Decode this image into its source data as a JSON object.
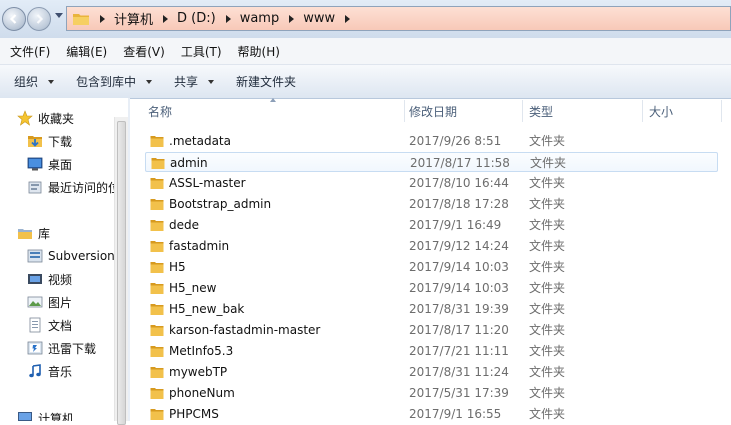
{
  "address_bar": {
    "crumbs": [
      "计算机",
      "D (D:)",
      "wamp",
      "www"
    ]
  },
  "menu": [
    "文件(F)",
    "编辑(E)",
    "查看(V)",
    "工具(T)",
    "帮助(H)"
  ],
  "commands": [
    {
      "label": "组织",
      "dropdown": true
    },
    {
      "label": "包含到库中",
      "dropdown": true
    },
    {
      "label": "共享",
      "dropdown": true
    },
    {
      "label": "新建文件夹",
      "dropdown": false
    }
  ],
  "nav_pane": {
    "favorites": {
      "label": "收藏夹",
      "icon": "star-icon",
      "items": [
        {
          "label": "下载",
          "icon": "download-folder-icon"
        },
        {
          "label": "桌面",
          "icon": "desktop-icon"
        },
        {
          "label": "最近访问的位",
          "icon": "recent-places-icon"
        }
      ]
    },
    "libraries": {
      "label": "库",
      "icon": "library-icon",
      "items": [
        {
          "label": "Subversion",
          "icon": "subversion-library-icon"
        },
        {
          "label": "视频",
          "icon": "video-library-icon"
        },
        {
          "label": "图片",
          "icon": "pictures-library-icon"
        },
        {
          "label": "文档",
          "icon": "documents-library-icon"
        },
        {
          "label": "迅雷下载",
          "icon": "thunder-download-icon"
        },
        {
          "label": "音乐",
          "icon": "music-library-icon"
        }
      ]
    },
    "computer": {
      "label": "计算机",
      "icon": "computer-icon"
    }
  },
  "columns": {
    "name": "名称",
    "date": "修改日期",
    "type": "类型",
    "size": "大小"
  },
  "files": [
    {
      "name": ".metadata",
      "date": "2017/9/26 8:51",
      "type": "文件夹"
    },
    {
      "name": "admin",
      "date": "2017/8/17 11:58",
      "type": "文件夹"
    },
    {
      "name": "ASSL-master",
      "date": "2017/8/10 16:44",
      "type": "文件夹"
    },
    {
      "name": "Bootstrap_admin",
      "date": "2017/8/18 17:28",
      "type": "文件夹"
    },
    {
      "name": "dede",
      "date": "2017/9/1 16:49",
      "type": "文件夹"
    },
    {
      "name": "fastadmin",
      "date": "2017/9/12 14:24",
      "type": "文件夹"
    },
    {
      "name": "H5",
      "date": "2017/9/14 10:03",
      "type": "文件夹"
    },
    {
      "name": "H5_new",
      "date": "2017/9/14 10:03",
      "type": "文件夹"
    },
    {
      "name": "H5_new_bak",
      "date": "2017/8/31 19:39",
      "type": "文件夹"
    },
    {
      "name": "karson-fastadmin-master",
      "date": "2017/8/17 11:20",
      "type": "文件夹"
    },
    {
      "name": "MetInfo5.3",
      "date": "2017/7/21 11:11",
      "type": "文件夹"
    },
    {
      "name": "mywebTP",
      "date": "2017/8/31 11:24",
      "type": "文件夹"
    },
    {
      "name": "phoneNum",
      "date": "2017/5/31 17:39",
      "type": "文件夹"
    },
    {
      "name": "PHPCMS",
      "date": "2017/9/1 16:55",
      "type": "文件夹"
    }
  ],
  "hovered_index": 1,
  "colors": {
    "folder": "#f2c14b",
    "folder_dark": "#d79a1f",
    "address_bg": "#f8c9b8",
    "hover_border": "#c7dcf2"
  }
}
